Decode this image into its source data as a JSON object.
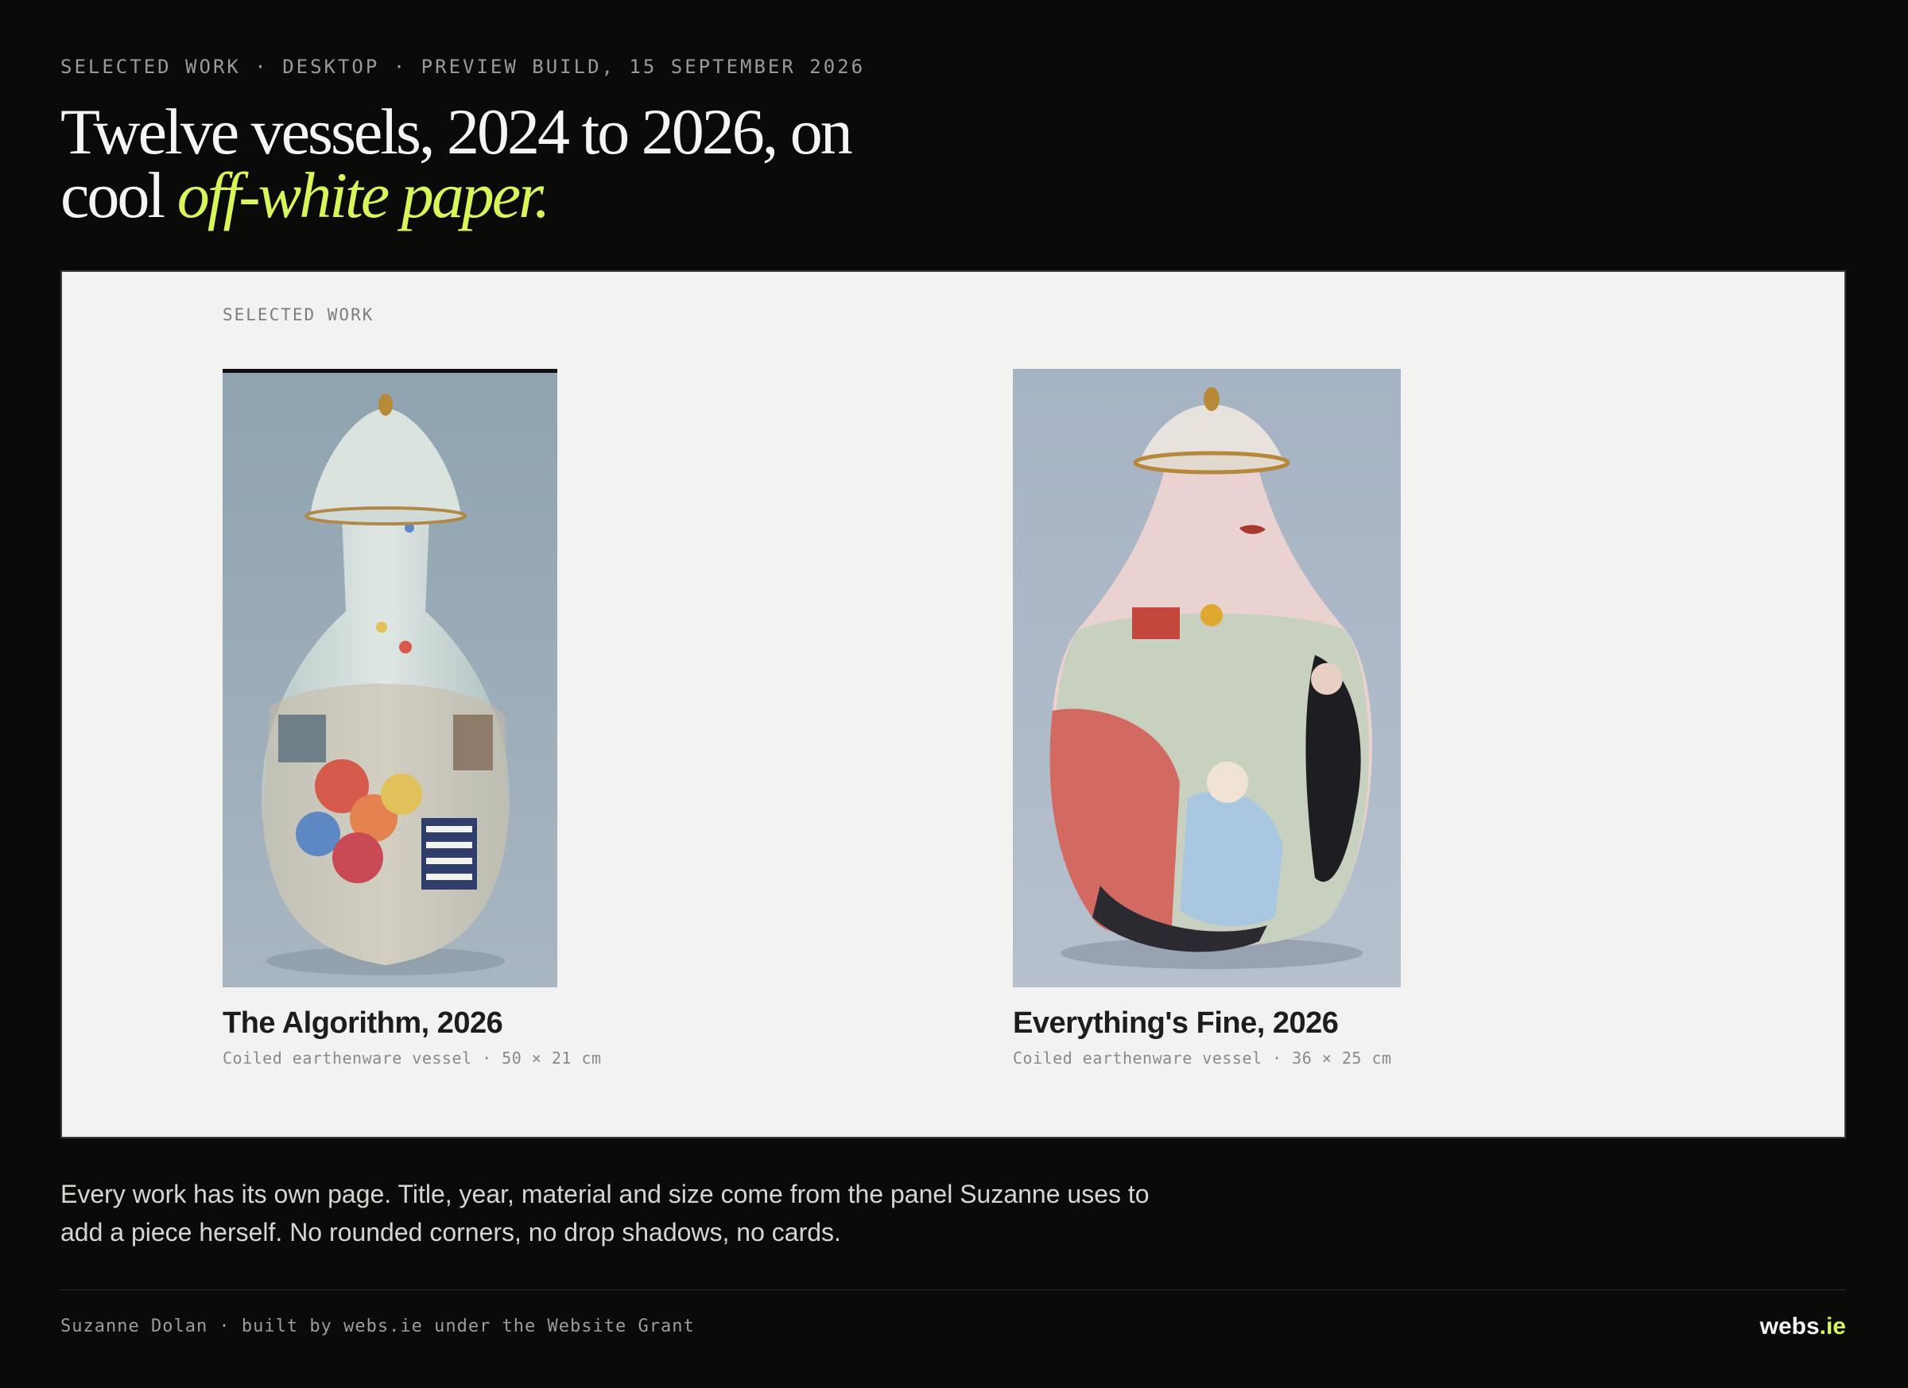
{
  "header": {
    "kicker": "SELECTED WORK · DESKTOP · PREVIEW BUILD, 15 SEPTEMBER 2026",
    "headline_line1": "Twelve vessels, 2024 to 2026, on",
    "headline_line2_plain": "cool",
    "headline_line2_accent": "off-white paper."
  },
  "panel": {
    "label": "SELECTED WORK",
    "works": [
      {
        "title": "The Algorithm, 2026",
        "meta": "Coiled earthenware vessel · 50 × 21 cm"
      },
      {
        "title": "Everything's Fine, 2026",
        "meta": "Coiled earthenware vessel · 36 × 25 cm"
      }
    ]
  },
  "body": {
    "text": "Every work has its own page. Title, year, material and size come from the panel Suzanne uses to add a piece herself. No rounded corners, no drop shadows, no cards."
  },
  "footer": {
    "credit": "Suzanne Dolan · built by webs.ie under the Website Grant",
    "logo_main": "webs",
    "logo_tld": ".ie"
  },
  "colors": {
    "background": "#0a0a09",
    "accent": "#d7f65a",
    "paper": "#f2f2f0"
  }
}
